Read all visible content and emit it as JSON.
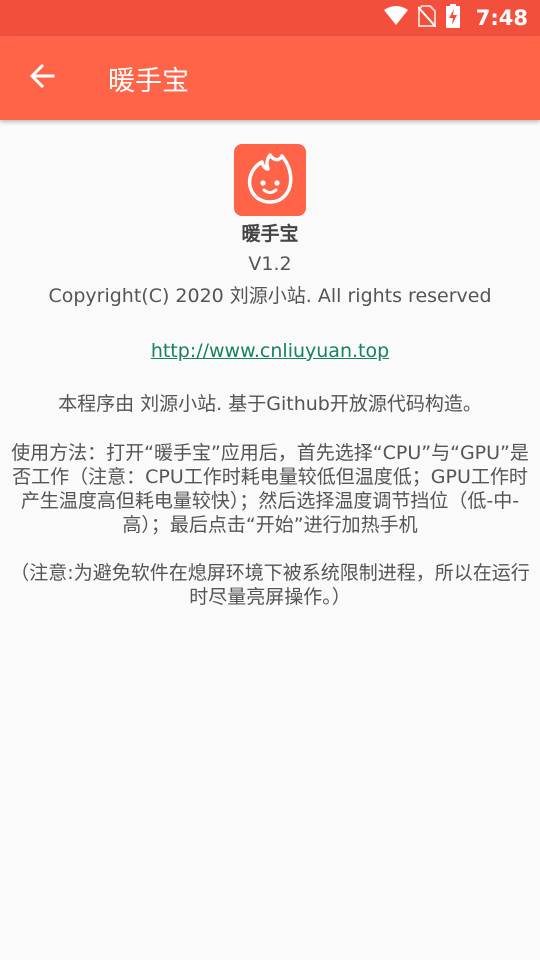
{
  "status_bar": {
    "time": "7:48",
    "icons": [
      "wifi-icon",
      "no-sim-icon",
      "battery-charging-icon"
    ]
  },
  "app_bar": {
    "title": "暖手宝",
    "back_icon": "arrow-left-icon"
  },
  "about": {
    "app_name": "暖手宝",
    "version": "V1.2",
    "copyright": "Copyright(C) 2020 刘源小站. All rights reserved",
    "website": "http://www.cnliuyuan.top",
    "source_note": "本程序由 刘源小站. 基于Github开放源代码构造。",
    "usage": "使用方法：打开“暖手宝”应用后，首先选择“CPU”与“GPU”是否工作（注意：CPU工作时耗电量较低但温度低；GPU工作时产生温度高但耗电量较快）；然后选择温度调节挡位（低-中-高）；最后点击“开始”进行加热手机",
    "notice": "（注意:为避免软件在熄屏环境下被系统限制进程，所以在运行时尽量亮屏操作。）"
  },
  "colors": {
    "status_bar": "#f2503c",
    "app_bar": "#ff6348",
    "link": "#16835a"
  }
}
